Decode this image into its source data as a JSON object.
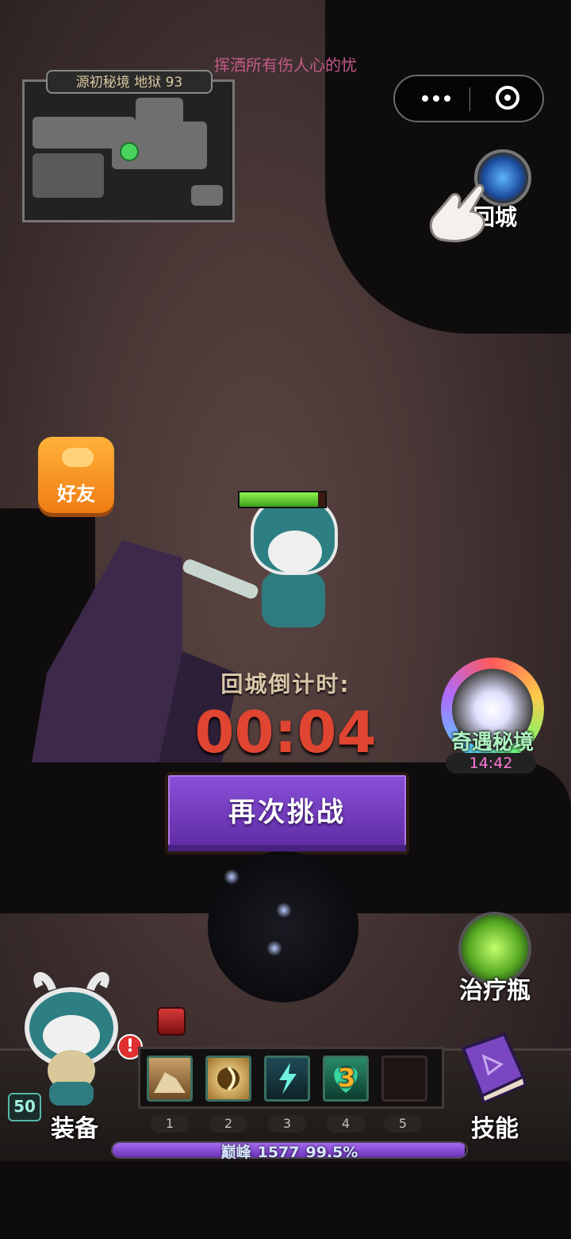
{
  "banner_text": "挥洒所有伤人心的忧",
  "minimap": {
    "title": "源初秘境 地狱 93"
  },
  "buttons": {
    "return_town": "回城",
    "friends": "好友",
    "challenge_again": "再次挑战",
    "event_realm": "奇遇秘境",
    "event_realm_timer": "14:42",
    "heal_potion": "治疗瓶",
    "equipment": "装备",
    "skills": "技能"
  },
  "countdown": {
    "label": "回城倒计时:",
    "value": "00:04"
  },
  "player": {
    "level": "50",
    "hp_fraction": 0.92,
    "alert": "!"
  },
  "skill_slots": [
    {
      "number": "1",
      "icon": "rock-skill-icon"
    },
    {
      "number": "2",
      "icon": "golden-burst-skill-icon"
    },
    {
      "number": "3",
      "icon": "lightning-skill-icon"
    },
    {
      "number": "4",
      "icon": "heart-skill-icon",
      "charges": "3"
    },
    {
      "number": "5",
      "icon": ""
    }
  ],
  "xp": {
    "tier": "巅峰",
    "level": "1577",
    "percent_text": "99.5%",
    "fraction": 0.995
  },
  "colors": {
    "countdown": "#e04532",
    "challenge_button": "#7a3fc8",
    "friend_button": "#f59a25"
  }
}
